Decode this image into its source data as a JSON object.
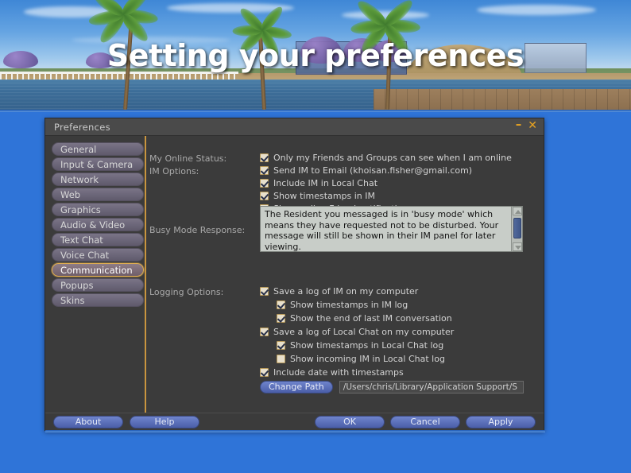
{
  "slide": {
    "title": "Setting your preferences"
  },
  "window": {
    "title": "Preferences",
    "minimize_icon": "minimize-icon",
    "close_icon": "close-icon",
    "minimize_glyph": "–",
    "close_glyph": "✕"
  },
  "sidebar": {
    "items": [
      {
        "label": "General",
        "selected": false
      },
      {
        "label": "Input & Camera",
        "selected": false
      },
      {
        "label": "Network",
        "selected": false
      },
      {
        "label": "Web",
        "selected": false
      },
      {
        "label": "Graphics",
        "selected": false
      },
      {
        "label": "Audio & Video",
        "selected": false
      },
      {
        "label": "Text Chat",
        "selected": false
      },
      {
        "label": "Voice Chat",
        "selected": false
      },
      {
        "label": "Communication",
        "selected": true
      },
      {
        "label": "Popups",
        "selected": false
      },
      {
        "label": "Skins",
        "selected": false
      }
    ]
  },
  "content": {
    "labels": {
      "online_status": "My Online Status:",
      "im_options": "IM Options:",
      "busy_mode": "Busy Mode Response:",
      "logging_options": "Logging Options:"
    },
    "online_status_checkboxes": [
      {
        "label": "Only my Friends and Groups can see when I am online",
        "checked": true
      }
    ],
    "im_options_checkboxes": [
      {
        "label": "Send IM to Email (khoisan.fisher@gmail.com)",
        "checked": true
      },
      {
        "label": "Include IM in Local Chat",
        "checked": true
      },
      {
        "label": "Show timestamps in IM",
        "checked": true
      },
      {
        "label": "Show online Friend notifications",
        "checked": true
      }
    ],
    "busy_mode_response": "The Resident you messaged is in 'busy mode' which means they have requested not to be disturbed.  Your message will still be shown in their IM panel for later viewing.",
    "logging_checkboxes": [
      {
        "label": "Save a log of IM on my computer",
        "checked": true,
        "indent": 0
      },
      {
        "label": "Show timestamps in IM log",
        "checked": true,
        "indent": 1
      },
      {
        "label": "Show the end of last IM conversation",
        "checked": true,
        "indent": 1
      },
      {
        "label": "Save a log of Local Chat on my computer",
        "checked": true,
        "indent": 0
      },
      {
        "label": "Show timestamps in Local Chat log",
        "checked": true,
        "indent": 1
      },
      {
        "label": "Show incoming IM in Local Chat log",
        "checked": false,
        "indent": 1
      },
      {
        "label": "Include date with timestamps",
        "checked": true,
        "indent": 0
      }
    ],
    "change_path_button": "Change Path",
    "log_path_value": "/Users/chris/Library/Application Support/S"
  },
  "footer": {
    "about": "About",
    "help": "Help",
    "ok": "OK",
    "cancel": "Cancel",
    "apply": "Apply"
  },
  "colors": {
    "desktop_blue": "#2f74d8",
    "accent_gold": "#c9953f",
    "window_btn_orange": "#e8a321",
    "button_blue": "#4a5ea8",
    "checkbox_cream": "#e8e0cc"
  }
}
